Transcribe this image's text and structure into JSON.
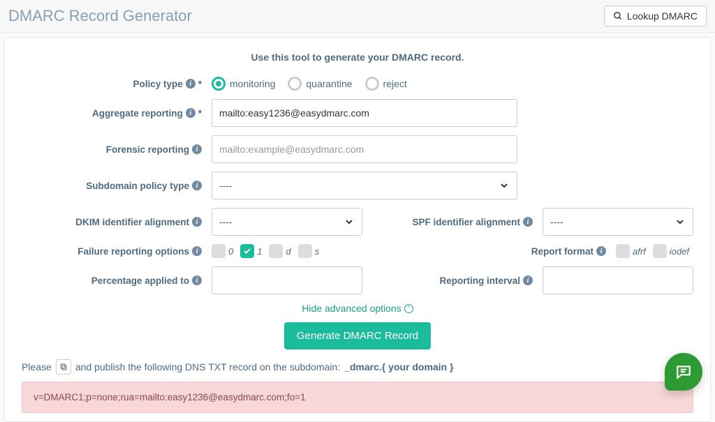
{
  "header": {
    "title": "DMARC Record Generator",
    "lookup_label": "Lookup DMARC"
  },
  "intro": "Use this tool to generate your DMARC record.",
  "labels": {
    "policy_type": "Policy type",
    "aggregate_reporting": "Aggregate reporting",
    "forensic_reporting": "Forensic reporting",
    "subdomain_policy": "Subdomain policy type",
    "dkim_alignment": "DKIM identifier alignment",
    "spf_alignment": "SPF identifier alignment",
    "failure_options": "Failure reporting options",
    "report_format": "Report format",
    "percentage": "Percentage applied to",
    "reporting_interval": "Reporting interval"
  },
  "policy_options": {
    "monitoring": "monitoring",
    "quarantine": "quarantine",
    "reject": "reject"
  },
  "inputs": {
    "aggregate_value": "mailto:easy1236@easydmarc.com",
    "forensic_placeholder": "mailto:example@easydmarc.com",
    "subdomain_value": "----",
    "dkim_value": "----",
    "spf_value": "----",
    "percentage_value": "",
    "interval_value": ""
  },
  "failure_opts": {
    "zero": "0",
    "one": "1",
    "d": "d",
    "s": "s"
  },
  "report_format_opts": {
    "afrf": "afrf",
    "iodef": "iodef"
  },
  "toggle_advanced": "Hide advanced options",
  "generate_label": "Generate DMARC Record",
  "instruction": {
    "prefix": "Please",
    "mid": "and publish the following DNS TXT record on the subdomain:",
    "suffix": "_dmarc.{ your domain }"
  },
  "record": "v=DMARC1;p=none;rua=mailto:easy1236@easydmarc.com;fo=1"
}
